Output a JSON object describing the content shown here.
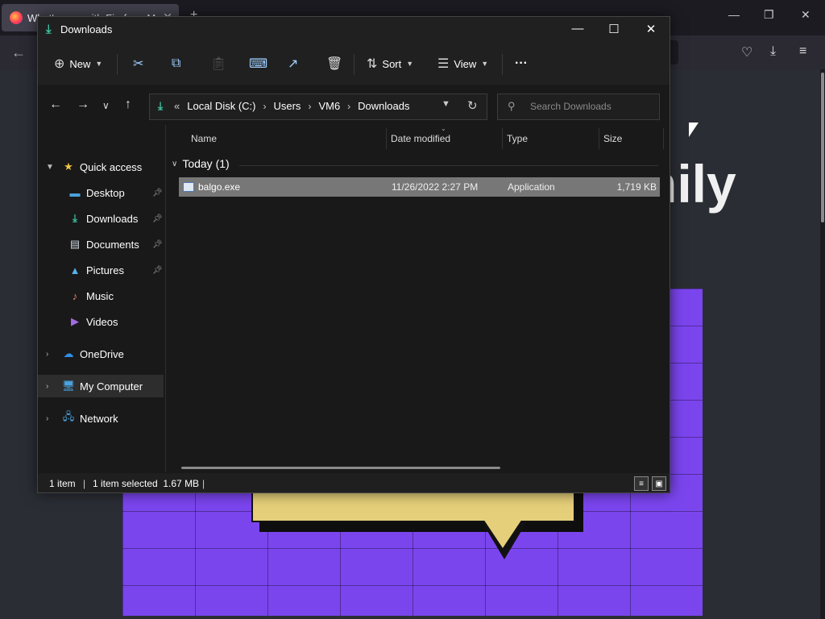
{
  "browser": {
    "tab_title": "What's new with Firefox - Mo",
    "bg_heading": "nily",
    "icons": [
      "firefox-icon",
      "pocket-icon",
      "downloads-icon",
      "menu-icon"
    ]
  },
  "explorer": {
    "title": "Downloads",
    "command_bar": {
      "new_label": "New",
      "sort_label": "Sort",
      "view_label": "View",
      "more_label": "···"
    },
    "address": {
      "overflow": "«",
      "crumbs": [
        "Local Disk (C:)",
        "Users",
        "VM6",
        "Downloads"
      ]
    },
    "search_placeholder": "Search Downloads",
    "nav": {
      "quick_access": "Quick access",
      "desktop": "Desktop",
      "downloads": "Downloads",
      "documents": "Documents",
      "pictures": "Pictures",
      "music": "Music",
      "videos": "Videos",
      "onedrive": "OneDrive",
      "my_computer": "My Computer",
      "network": "Network"
    },
    "columns": {
      "name": "Name",
      "date_modified": "Date modified",
      "type": "Type",
      "size": "Size"
    },
    "group_label": "Today (1)",
    "files": [
      {
        "name": "balgo.exe",
        "date": "11/26/2022 2:27 PM",
        "type": "Application",
        "size": "1,719 KB"
      }
    ],
    "status": {
      "count": "1 item",
      "selected": "1 item selected  1.67 MB"
    }
  }
}
